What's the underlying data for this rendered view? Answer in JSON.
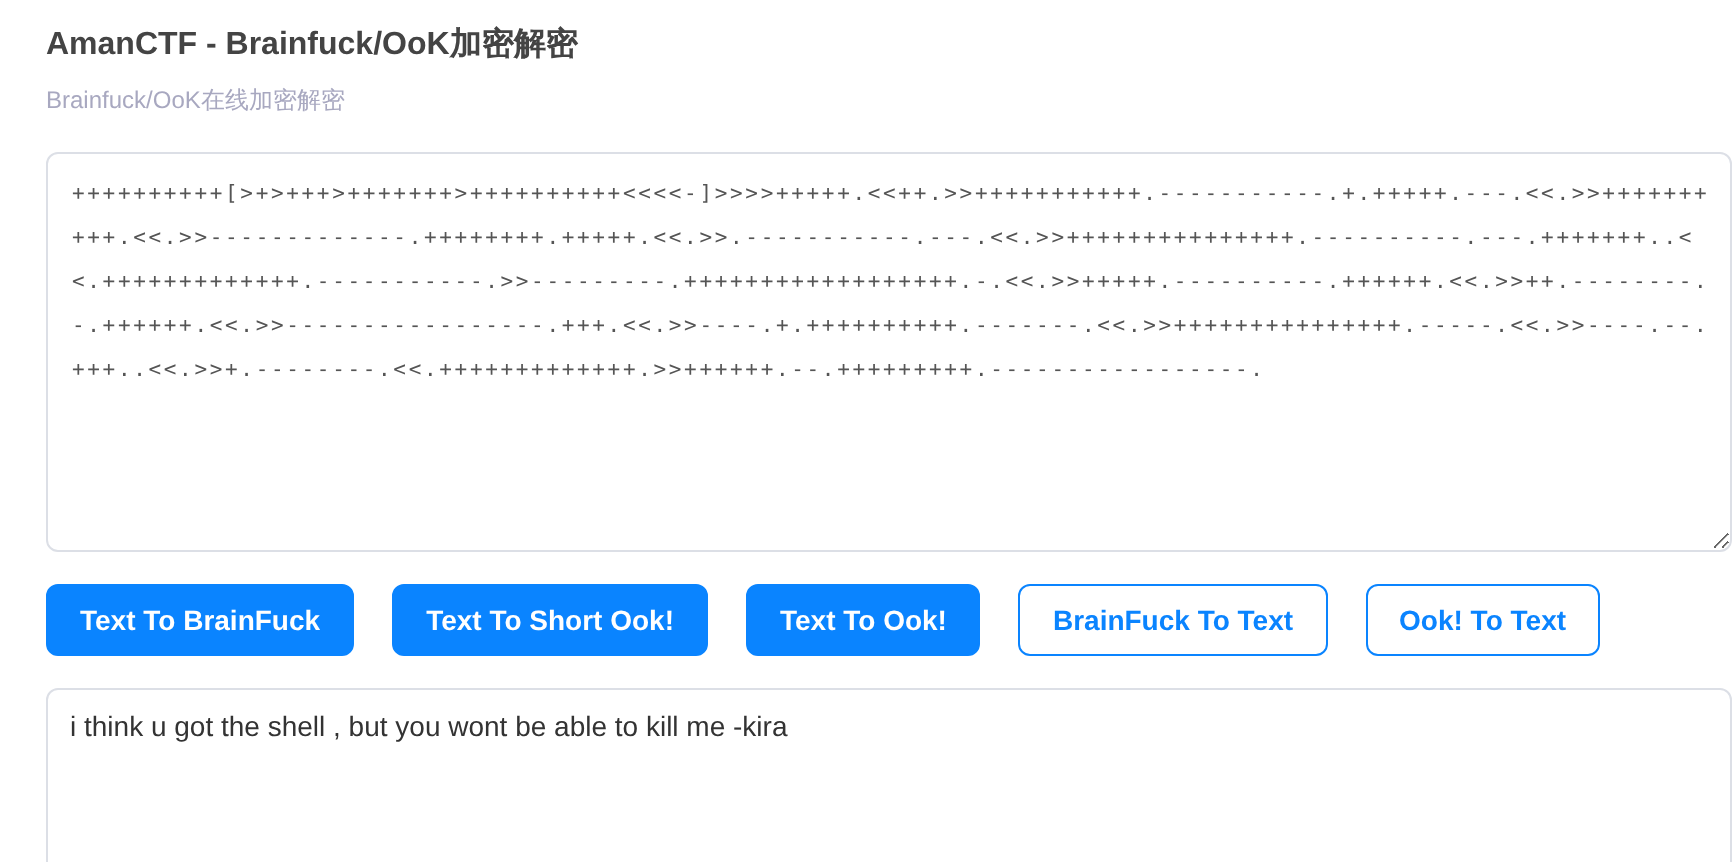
{
  "header": {
    "title": "AmanCTF - Brainfuck/OoK加密解密",
    "subtitle": "Brainfuck/OoK在线加密解密"
  },
  "input": {
    "value": "++++++++++[>+>+++>+++++++>++++++++++<<<<-]>>>>+++++.<<++.>>+++++++++++.-----------.+.+++++.---.<<.>>++++++++++.<<.>>-------------.++++++++.+++++.<<.>>.-----------.---.<<.>>+++++++++++++++.----------.---.+++++++..<<.+++++++++++++.-----------.>>---------.++++++++++++++++++.-.<<.>>+++++.----------.++++++.<<.>>++.--------.-.++++++.<<.>>-----------------.+++.<<.>>----.+.++++++++++.-------.<<.>>+++++++++++++++.-----.<<.>>----.--.+++..<<.>>+.--------.<<.+++++++++++++.>>++++++.--.+++++++++.-----------------."
  },
  "buttons": [
    {
      "label": "Text To BrainFuck",
      "kind": "filled"
    },
    {
      "label": "Text To Short Ook!",
      "kind": "filled"
    },
    {
      "label": "Text To Ook!",
      "kind": "filled"
    },
    {
      "label": "BrainFuck To Text",
      "kind": "outline"
    },
    {
      "label": "Ook! To Text",
      "kind": "outline"
    }
  ],
  "output": {
    "value": "i think u got the shell , but you wont be able to kill me -kira"
  }
}
